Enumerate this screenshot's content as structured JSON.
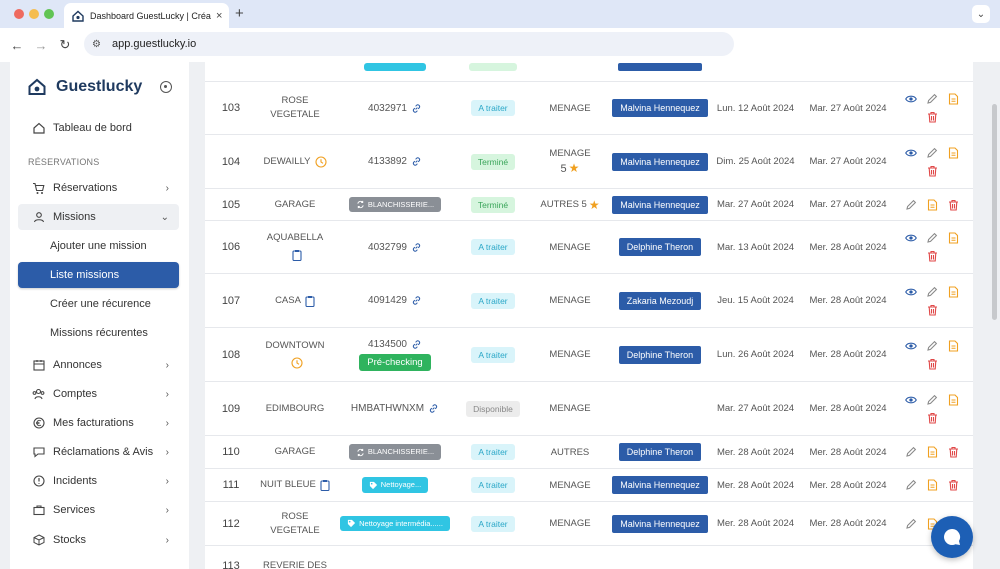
{
  "browser": {
    "tab_title": "Dashboard GuestLucky | Créa",
    "tab_close": "×",
    "new_tab": "+",
    "url": "app.guestlucky.io"
  },
  "sidebar": {
    "brand": "Guestlucky",
    "dashboard": "Tableau de bord",
    "section_label": "RÉSERVATIONS",
    "items": [
      {
        "label": "Réservations",
        "icon": "cart-icon"
      },
      {
        "label": "Missions",
        "icon": "user-icon"
      },
      {
        "label": "Ajouter une mission"
      },
      {
        "label": "Liste missions"
      },
      {
        "label": "Créer une récurence"
      },
      {
        "label": "Missions récurentes"
      },
      {
        "label": "Annonces",
        "icon": "calendar-icon"
      },
      {
        "label": "Comptes",
        "icon": "users-icon"
      },
      {
        "label": "Mes facturations",
        "icon": "euro-icon"
      },
      {
        "label": "Réclamations & Avis",
        "icon": "chat-icon"
      },
      {
        "label": "Incidents",
        "icon": "alert-icon"
      },
      {
        "label": "Services",
        "icon": "briefcase-icon"
      },
      {
        "label": "Stocks",
        "icon": "box-icon"
      }
    ]
  },
  "rows": [
    {
      "id": "103",
      "name": "ROSE VEGETALE",
      "ref": "4032971",
      "status": "A traiter",
      "type": "MENAGE",
      "who": "Malvina Hennequez",
      "d1": "Lun. 12 Août 2024",
      "d2": "Mar. 27 Août 2024"
    },
    {
      "id": "104",
      "name": "DEWAILLY",
      "ref": "4133892",
      "status": "Terminé",
      "type": "MENAGE",
      "rating": "5",
      "who": "Malvina Hennequez",
      "d1": "Dim. 25 Août 2024",
      "d2": "Mar. 27 Août 2024"
    },
    {
      "id": "105",
      "name": "GARAGE",
      "ref": "BLANCHISSERIE...",
      "status": "Terminé",
      "type": "AUTRES 5",
      "who": "Malvina Hennequez",
      "d1": "Mar. 27 Août 2024",
      "d2": "Mar. 27 Août 2024"
    },
    {
      "id": "106",
      "name": "AQUABELLA",
      "ref": "4032799",
      "status": "A traiter",
      "type": "MENAGE",
      "who": "Delphine Theron",
      "d1": "Mar. 13 Août 2024",
      "d2": "Mer. 28 Août 2024"
    },
    {
      "id": "107",
      "name": "CASA",
      "ref": "4091429",
      "status": "A traiter",
      "type": "MENAGE",
      "who": "Zakaria Mezoudj",
      "d1": "Jeu. 15 Août 2024",
      "d2": "Mer. 28 Août 2024"
    },
    {
      "id": "108",
      "name": "DOWNTOWN",
      "ref": "4134500",
      "pre": "Pré-checking",
      "status": "A traiter",
      "type": "MENAGE",
      "who": "Delphine Theron",
      "d1": "Lun. 26 Août 2024",
      "d2": "Mer. 28 Août 2024"
    },
    {
      "id": "109",
      "name": "EDIMBOURG",
      "ref": "HMBATHWNXM",
      "status": "Disponible",
      "type": "MENAGE",
      "who": "",
      "d1": "Mar. 27 Août 2024",
      "d2": "Mer. 28 Août 2024"
    },
    {
      "id": "110",
      "name": "GARAGE",
      "ref": "BLANCHISSERIE...",
      "status": "A traiter",
      "type": "AUTRES",
      "who": "Delphine Theron",
      "d1": "Mer. 28 Août 2024",
      "d2": "Mer. 28 Août 2024"
    },
    {
      "id": "111",
      "name": "NUIT BLEUE",
      "ref": "Nettoyage...",
      "status": "A traiter",
      "type": "MENAGE",
      "who": "Malvina Hennequez",
      "d1": "Mer. 28 Août 2024",
      "d2": "Mer. 28 Août 2024"
    },
    {
      "id": "112",
      "name": "ROSE VEGETALE",
      "ref": "Nettoyage intermédia......",
      "status": "A traiter",
      "type": "MENAGE",
      "who": "Malvina Hennequez",
      "d1": "Mer. 28 Août 2024",
      "d2": "Mer. 28 Août 2024"
    },
    {
      "id": "113",
      "name": "REVERIE DES",
      "ref": "",
      "status": "",
      "type": "",
      "who": "",
      "d1": "",
      "d2": ""
    }
  ],
  "colors": {
    "primary": "#2c5ca8",
    "trait": "#2aa7c7",
    "done": "#3aa55a",
    "edit": "#888888",
    "doc": "#f0a020",
    "delete": "#e04848",
    "view": "#2c5ca8"
  }
}
